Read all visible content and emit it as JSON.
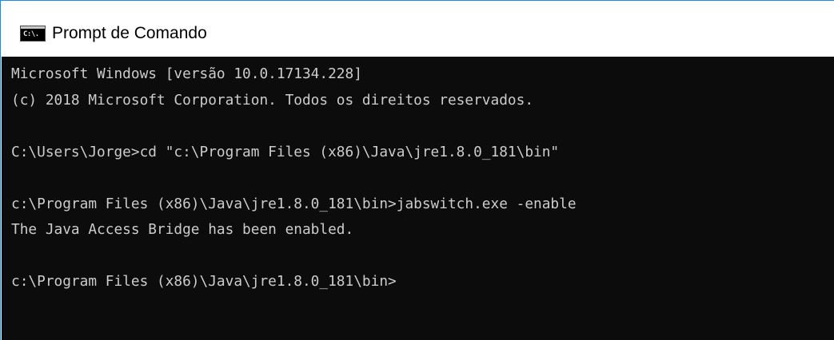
{
  "window": {
    "title": "Prompt de Comando",
    "icon": "cmd-app-icon",
    "icon_glyph": "C:\\."
  },
  "console": {
    "background_color": "#0c0c0c",
    "text_color": "#cccccc",
    "lines": [
      "Microsoft Windows [versão 10.0.17134.228]",
      "(c) 2018 Microsoft Corporation. Todos os direitos reservados.",
      "",
      "C:\\Users\\Jorge>cd \"c:\\Program Files (x86)\\Java\\jre1.8.0_181\\bin\"",
      "",
      "c:\\Program Files (x86)\\Java\\jre1.8.0_181\\bin>jabswitch.exe -enable",
      "The Java Access Bridge has been enabled.",
      "",
      "c:\\Program Files (x86)\\Java\\jre1.8.0_181\\bin>"
    ]
  }
}
